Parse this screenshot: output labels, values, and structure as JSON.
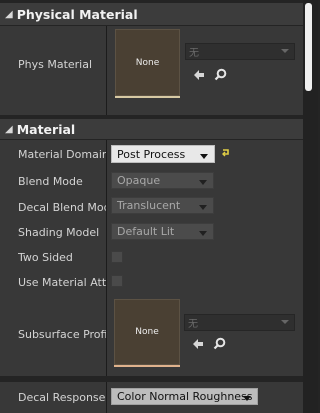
{
  "physical_material": {
    "title": "Physical Material",
    "row_label": "Phys Material",
    "thumbnail_text": "None",
    "combo_value": "无"
  },
  "material": {
    "title": "Material",
    "rows": {
      "material_domain": {
        "label": "Material Domain",
        "value": "Post Process"
      },
      "blend_mode": {
        "label": "Blend Mode",
        "value": "Opaque"
      },
      "decal_blend_mode": {
        "label": "Decal Blend Mode",
        "value": "Translucent"
      },
      "shading_model": {
        "label": "Shading Model",
        "value": "Default Lit"
      },
      "two_sided": {
        "label": "Two Sided"
      },
      "use_material_attributes": {
        "label": "Use Material Attri"
      },
      "subsurface_profile": {
        "label": "Subsurface Profil",
        "thumbnail_text": "None",
        "combo_value": "无"
      }
    }
  },
  "decal_response": {
    "label": "Decal Response (",
    "value": "Color Normal Roughness"
  },
  "colors": {
    "accent_reset": "#e2d045",
    "panel": "#383838",
    "header": "#3c3c3c"
  }
}
